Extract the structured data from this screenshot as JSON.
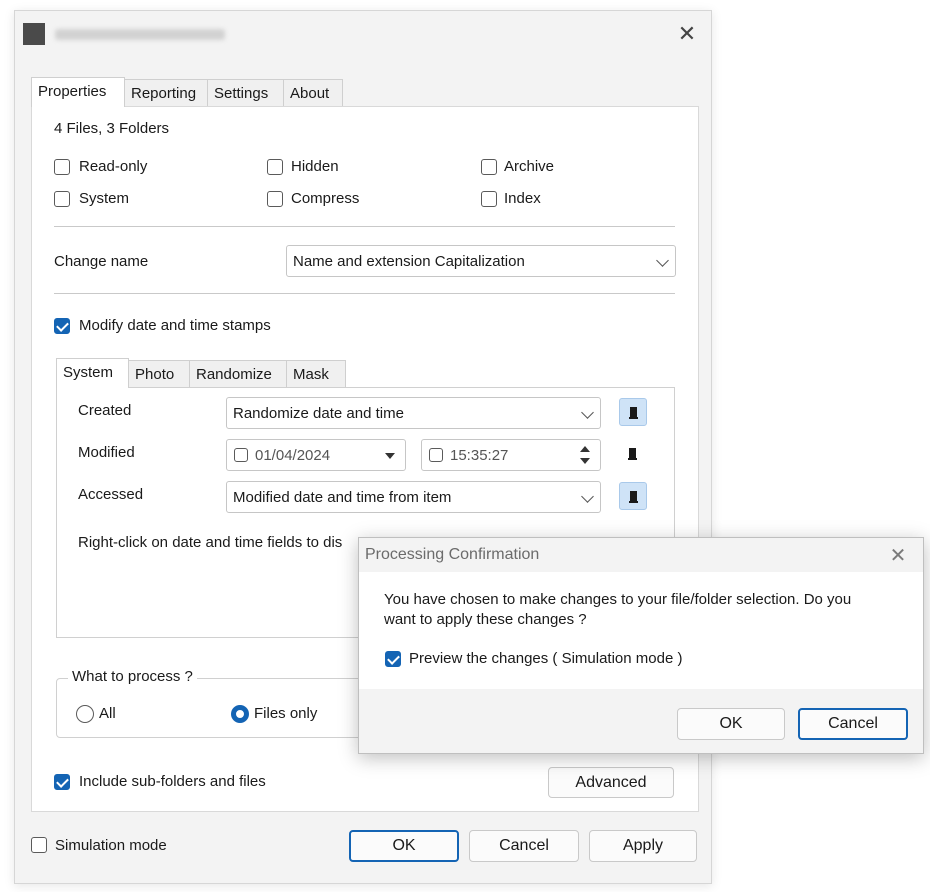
{
  "window": {
    "title": "",
    "close_glyph": "✕"
  },
  "tabs": [
    "Properties",
    "Reporting",
    "Settings",
    "About"
  ],
  "properties": {
    "selection_summary": "4 Files, 3 Folders",
    "attributes": {
      "read_only": {
        "label": "Read-only",
        "checked": false
      },
      "hidden": {
        "label": "Hidden",
        "checked": false
      },
      "archive": {
        "label": "Archive",
        "checked": false
      },
      "system": {
        "label": "System",
        "checked": false
      },
      "compress": {
        "label": "Compress",
        "checked": false
      },
      "index": {
        "label": "Index",
        "checked": false
      }
    },
    "change_name": {
      "label": "Change name",
      "value": "Name and extension Capitalization"
    },
    "modify_dates": {
      "label": "Modify date and time stamps",
      "checked": true
    },
    "date_tabs": [
      "System",
      "Photo",
      "Randomize",
      "Mask"
    ],
    "created": {
      "label": "Created",
      "value": "Randomize date and time"
    },
    "modified": {
      "label": "Modified",
      "date": "01/04/2024",
      "time": "15:35:27"
    },
    "accessed": {
      "label": "Accessed",
      "value": "Modified date and time from item"
    },
    "hint": "Right-click on date and time fields to dis",
    "what_to_process": {
      "label": "What to process ?",
      "options": [
        {
          "label": "All",
          "selected": false
        },
        {
          "label": "Files only",
          "selected": true
        }
      ]
    },
    "include_subfolders": {
      "label": "Include sub-folders and files",
      "checked": true
    },
    "advanced_label": "Advanced"
  },
  "footer": {
    "simulation_mode": {
      "label": "Simulation mode",
      "checked": false
    },
    "ok": "OK",
    "cancel": "Cancel",
    "apply": "Apply"
  },
  "dialog": {
    "title": "Processing Confirmation",
    "close_glyph": "✕",
    "message_line1": "You have chosen to make changes to your file/folder selection.  Do you",
    "message_line2": "want to apply these changes ?",
    "preview": {
      "label": "Preview the changes ( Simulation mode )",
      "checked": true
    },
    "ok": "OK",
    "cancel": "Cancel"
  },
  "colors": {
    "accent": "#1464b4",
    "window_bg": "#f3f3f3",
    "panel_bg": "#ffffff"
  }
}
